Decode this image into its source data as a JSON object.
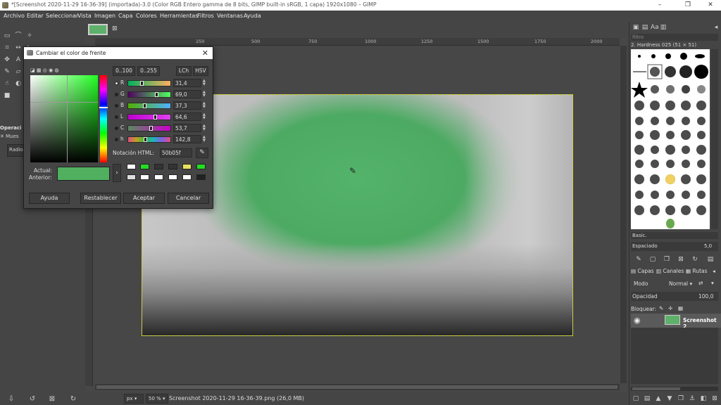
{
  "window": {
    "title": "*[Screenshot 2020-11-29 16-36-39] (importada)-3.0 (Color RGB Entero gamma de 8 bits, GIMP built-in sRGB, 1 capa) 1920x1080 – GIMP",
    "minimize": "–",
    "maximize": "❐",
    "close": "✕"
  },
  "menu": [
    "Archivo",
    "Editar",
    "Seleccionar",
    "Vista",
    "Imagen",
    "Capa",
    "Colores",
    "Herramientas",
    "Filtros",
    "Ventanas",
    "Ayuda"
  ],
  "toolbox": {
    "tool_options_tab": "Operaci",
    "tool_options_item": "Mues",
    "tool_options_field": "Radio"
  },
  "rulers": {
    "top": [
      "250",
      "500",
      "750",
      "1000",
      "1250",
      "1500",
      "1750",
      "2000"
    ]
  },
  "status": {
    "unit": "px",
    "zoom": "50 %",
    "text": "Screenshot 2020-11-29 16-36-39.png (26,0 MB)"
  },
  "dock": {
    "brush_filter_placeholder": "filtro",
    "brush_name": "2. Hardness 025 (51 × 51)",
    "brush_preset": "Basic.",
    "spacing_label": "Espaciado",
    "spacing_value": "5,0",
    "tabs": [
      "Capas",
      "Canales",
      "Rutas"
    ],
    "mode_label": "Modo",
    "mode_value": "Normal",
    "opacity_label": "Opacidad",
    "opacity_value": "100,0",
    "lock_label": "Bloquear:",
    "layer_name": "Screenshot 2"
  },
  "dialog": {
    "title": "Cambiar el color de frente",
    "close": "✕",
    "range_100": "0..100",
    "range_255": "0..255",
    "lch": "LCh",
    "hsv": "HSV",
    "channels": [
      {
        "label": "R",
        "value": "31,4",
        "level": 0.314
      },
      {
        "label": "G",
        "value": "69,0",
        "level": 0.69
      },
      {
        "label": "B",
        "value": "37,3",
        "level": 0.373
      },
      {
        "label": "L",
        "value": "64,6",
        "level": 0.646
      },
      {
        "label": "C",
        "value": "53,7",
        "level": 0.537
      },
      {
        "label": "h",
        "value": "142,8",
        "level": 0.397
      }
    ],
    "html_label": "Notación HTML:",
    "html_value": "50b05f",
    "current_label": "Actual:",
    "previous_label": "Anterior:",
    "current_color": "#50b05f",
    "buttons": {
      "help": "Ayuda",
      "reset": "Restablecer",
      "ok": "Aceptar",
      "cancel": "Cancelar"
    },
    "history_colors": [
      "#ffffff",
      "#22dd22",
      "#333333",
      "#333333",
      "#e8e060",
      "#22dd22",
      "#dddddd",
      "#ffffff",
      "#ffffff",
      "#ffffff",
      "#ffffff",
      "#222222"
    ]
  }
}
